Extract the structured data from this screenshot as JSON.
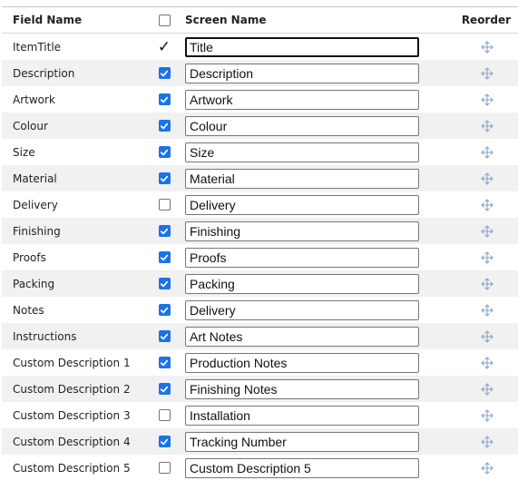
{
  "header": {
    "field_name": "Field Name",
    "screen_name": "Screen Name",
    "reorder": "Reorder",
    "select_all_checked": false
  },
  "rows": [
    {
      "field": "ItemTitle",
      "checked": "fixed",
      "screen": "Title",
      "focused": true
    },
    {
      "field": "Description",
      "checked": true,
      "screen": "Description"
    },
    {
      "field": "Artwork",
      "checked": true,
      "screen": "Artwork"
    },
    {
      "field": "Colour",
      "checked": true,
      "screen": "Colour"
    },
    {
      "field": "Size",
      "checked": true,
      "screen": "Size"
    },
    {
      "field": "Material",
      "checked": true,
      "screen": "Material"
    },
    {
      "field": "Delivery",
      "checked": false,
      "screen": "Delivery"
    },
    {
      "field": "Finishing",
      "checked": true,
      "screen": "Finishing"
    },
    {
      "field": "Proofs",
      "checked": true,
      "screen": "Proofs"
    },
    {
      "field": "Packing",
      "checked": true,
      "screen": "Packing"
    },
    {
      "field": "Notes",
      "checked": true,
      "screen": "Delivery"
    },
    {
      "field": "Instructions",
      "checked": true,
      "screen": "Art Notes"
    },
    {
      "field": "Custom Description 1",
      "checked": true,
      "screen": "Production Notes"
    },
    {
      "field": "Custom Description 2",
      "checked": true,
      "screen": "Finishing Notes"
    },
    {
      "field": "Custom Description 3",
      "checked": false,
      "screen": "Installation"
    },
    {
      "field": "Custom Description 4",
      "checked": true,
      "screen": "Tracking Number"
    },
    {
      "field": "Custom Description 5",
      "checked": false,
      "screen": "Custom Description 5"
    }
  ],
  "icons": {
    "fixed_check": "checkmark-icon",
    "reorder": "move-icon"
  },
  "colors": {
    "checkbox_accent": "#1a73e8",
    "row_alt": "#f1f1f1",
    "move_icon": "#8aa4c8"
  }
}
